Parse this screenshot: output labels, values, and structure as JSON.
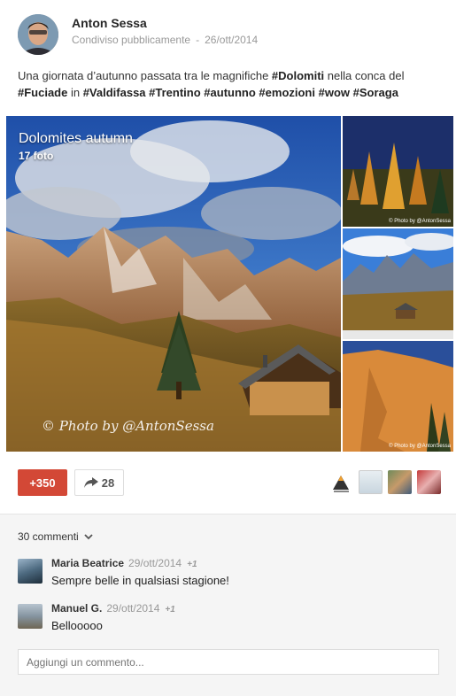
{
  "post": {
    "author": "Anton Sessa",
    "visibility": "Condiviso pubblicamente",
    "date": "26/ott/2014",
    "text_segments": [
      {
        "t": "Una giornata d’autunno passata tra le magnifiche ",
        "b": false
      },
      {
        "t": "#Dolomiti",
        "b": true
      },
      {
        "t": " nella conca del ",
        "b": false
      },
      {
        "t": "#Fuciade",
        "b": true
      },
      {
        "t": " in ",
        "b": false
      },
      {
        "t": "#Valdifassa",
        "b": true
      },
      {
        "t": " ",
        "b": false
      },
      {
        "t": "#Trentino",
        "b": true
      },
      {
        "t": " ",
        "b": false
      },
      {
        "t": "#autunno",
        "b": true
      },
      {
        "t": " ",
        "b": false
      },
      {
        "t": "#emozioni",
        "b": true
      },
      {
        "t": " ",
        "b": false
      },
      {
        "t": "#wow",
        "b": true
      },
      {
        "t": " ",
        "b": false
      },
      {
        "t": "#Soraga",
        "b": true
      }
    ]
  },
  "album": {
    "title": "Dolomites autumn",
    "count": "17 foto",
    "watermark": "© Photo by @AntonSessa",
    "thumb_watermark": "© Photo by @AntonSessa"
  },
  "actions": {
    "plus_count": "+350",
    "share_count": "28"
  },
  "comments": {
    "count_label": "30 commenti",
    "items": [
      {
        "name": "Maria Beatrice",
        "date": "29/ott/2014",
        "plus": "+1",
        "text": "Sempre belle in qualsiasi stagione!"
      },
      {
        "name": "Manuel G.",
        "date": "29/ott/2014",
        "plus": "+1",
        "text": "Bellooooo"
      }
    ],
    "placeholder": "Aggiungi un commento..."
  },
  "colors": {
    "plus_button": "#d34836",
    "comment_bg": "#f5f5f5"
  }
}
